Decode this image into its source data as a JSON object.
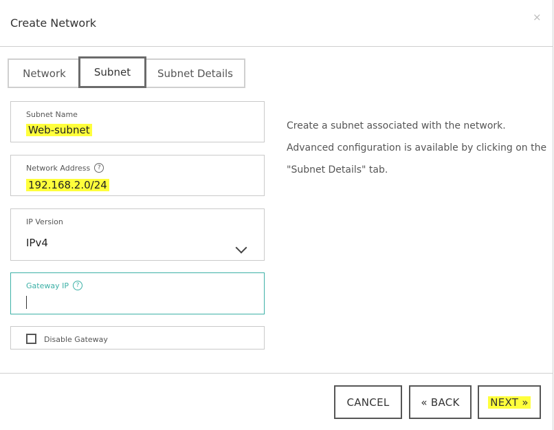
{
  "dialog": {
    "title": "Create Network",
    "close_label": "×"
  },
  "tabs": [
    {
      "label": "Network",
      "active": false
    },
    {
      "label": "Subnet",
      "active": true
    },
    {
      "label": "Subnet Details",
      "active": false
    }
  ],
  "form": {
    "subnet_name": {
      "label": "Subnet Name",
      "value": "Web-subnet"
    },
    "network_address": {
      "label": "Network Address",
      "help": "?",
      "value": "192.168.2.0/24"
    },
    "ip_version": {
      "label": "IP Version",
      "value": "IPv4"
    },
    "gateway_ip": {
      "label": "Gateway IP",
      "help": "?",
      "value": "",
      "placeholder": ""
    },
    "disable_gateway": {
      "label": "Disable Gateway",
      "checked": false
    }
  },
  "description": {
    "line1": "Create a subnet associated with the network.",
    "line2": "Advanced configuration is available by clicking on the",
    "line3": "\"Subnet Details\" tab."
  },
  "footer": {
    "cancel": "CANCEL",
    "back": "« BACK",
    "next": "NEXT »"
  },
  "colors": {
    "highlight": "#ffff3c",
    "focus_teal": "#3bb0a6",
    "active_tab_border": "#6b6b6b"
  }
}
